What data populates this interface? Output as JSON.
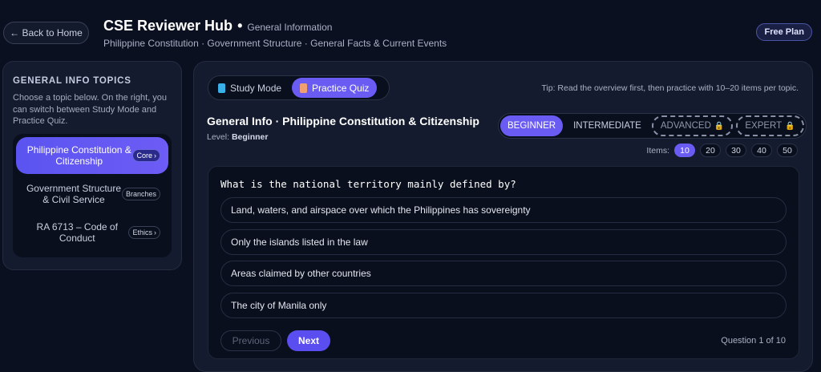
{
  "header": {
    "back_label": "← Back to Home",
    "title": "CSE Reviewer Hub",
    "separator": "•",
    "subtitle": "General Information",
    "breadcrumbs": "Philippine Constitution · Government Structure · General Facts & Current Events",
    "plan_badge": "Free Plan"
  },
  "sidebar": {
    "heading": "GENERAL INFO TOPICS",
    "description": "Choose a topic below. On the right, you can switch between Study Mode and Practice Quiz.",
    "topics": [
      {
        "label": "Philippine Constitution & Citizenship",
        "tag": "Core",
        "active": true
      },
      {
        "label": "Government Structure & Civil Service",
        "tag": "Branches",
        "active": false
      },
      {
        "label": "RA 6713 – Code of Conduct",
        "tag": "Ethics",
        "active": false
      }
    ]
  },
  "main": {
    "modes": [
      {
        "label": "Study Mode",
        "icon": "book-icon",
        "active": false
      },
      {
        "label": "Practice Quiz",
        "icon": "quiz-icon",
        "active": true
      }
    ],
    "tip": "Tip: Read the overview first, then practice with 10–20 items per topic.",
    "quiz_title": "General Info · Philippine Constitution & Citizenship",
    "level_label": "Level:",
    "level_value": "Beginner",
    "difficulties": [
      {
        "label": "BEGINNER",
        "active": true,
        "locked": false
      },
      {
        "label": "INTERMEDIATE",
        "active": false,
        "locked": false
      },
      {
        "label": "ADVANCED",
        "active": false,
        "locked": true
      },
      {
        "label": "EXPERT",
        "active": false,
        "locked": true
      }
    ],
    "items_label": "Items:",
    "item_counts": [
      "10",
      "20",
      "30",
      "40",
      "50"
    ],
    "items_selected": "10",
    "question": "What is the national territory mainly defined by?",
    "options": [
      "Land, waters, and airspace over which the Philippines has sovereignty",
      "Only the islands listed in the law",
      "Areas claimed by other countries",
      "The city of Manila only"
    ],
    "prev_label": "Previous",
    "next_label": "Next",
    "counter": "Question 1 of 10"
  },
  "colors": {
    "accent": "#6a5cf3",
    "background": "#0b1020",
    "panel": "#141b2e",
    "lock": "#e0a850"
  }
}
